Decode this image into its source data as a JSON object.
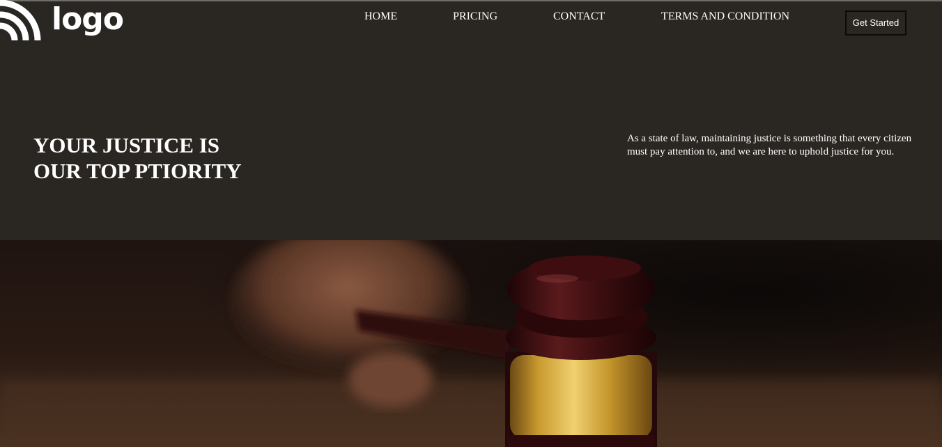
{
  "header": {
    "logo_text": "logo",
    "nav": [
      "HOME",
      "PRICING",
      "CONTACT",
      "TERMS AND CONDITION"
    ],
    "cta_label": "Get Started"
  },
  "hero": {
    "title_line1": "YOUR JUSTICE IS",
    "title_line2": "OUR TOP PTIORITY",
    "description": "As a state of law, maintaining justice is something that every citizen must pay attention to, and we are here to uphold justice for you."
  },
  "image": {
    "icon": "gavel-image"
  },
  "colors": {
    "background": "#2a2723",
    "text": "#ffffff",
    "button_border": "#0c0b0a",
    "gavel_wood": "#3e0f11",
    "gavel_band": "#c99a2e"
  }
}
